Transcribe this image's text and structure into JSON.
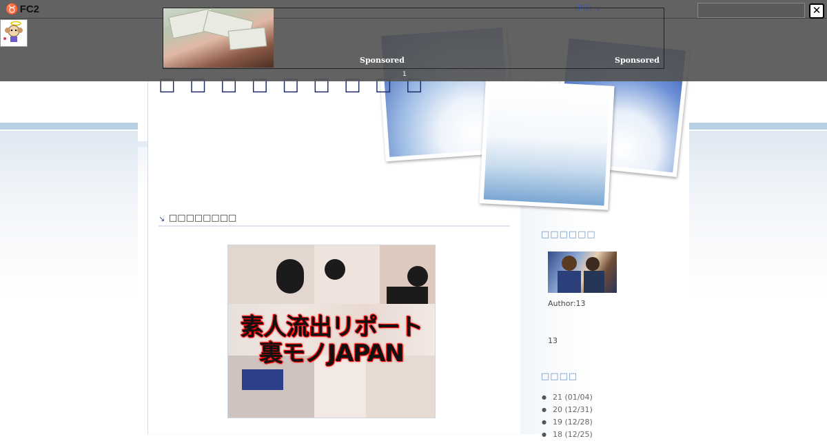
{
  "fc2": {
    "logo_text": "FC2",
    "pr_label": "[PR]",
    "close_glyph": "✕",
    "search_placeholder": ""
  },
  "ads": {
    "sponsored_1": "Sponsored",
    "sponsored_2": "Sponsored",
    "slide_index": "1"
  },
  "blog": {
    "title": "□ □ □ □ □ □ □ □ □"
  },
  "entry": {
    "title": "□□□□□□□□",
    "image_caption_line1": "素人流出リポート",
    "image_caption_line2": "裏モノJAPAN"
  },
  "sidebar": {
    "profile_heading": "□□□□□□",
    "author_label": "Author:13",
    "profile_text": "13",
    "archive_heading": "□□□□",
    "archive_items": [
      {
        "label": "21 (01/04)"
      },
      {
        "label": "20 (12/31)"
      },
      {
        "label": "19 (12/28)"
      },
      {
        "label": "18 (12/25)"
      }
    ]
  },
  "colors": {
    "title_color": "#1c2a6a",
    "side_heading_color": "#6d97c2",
    "overlay_color": "#555555",
    "stripe_color": "#b9cfe4"
  }
}
